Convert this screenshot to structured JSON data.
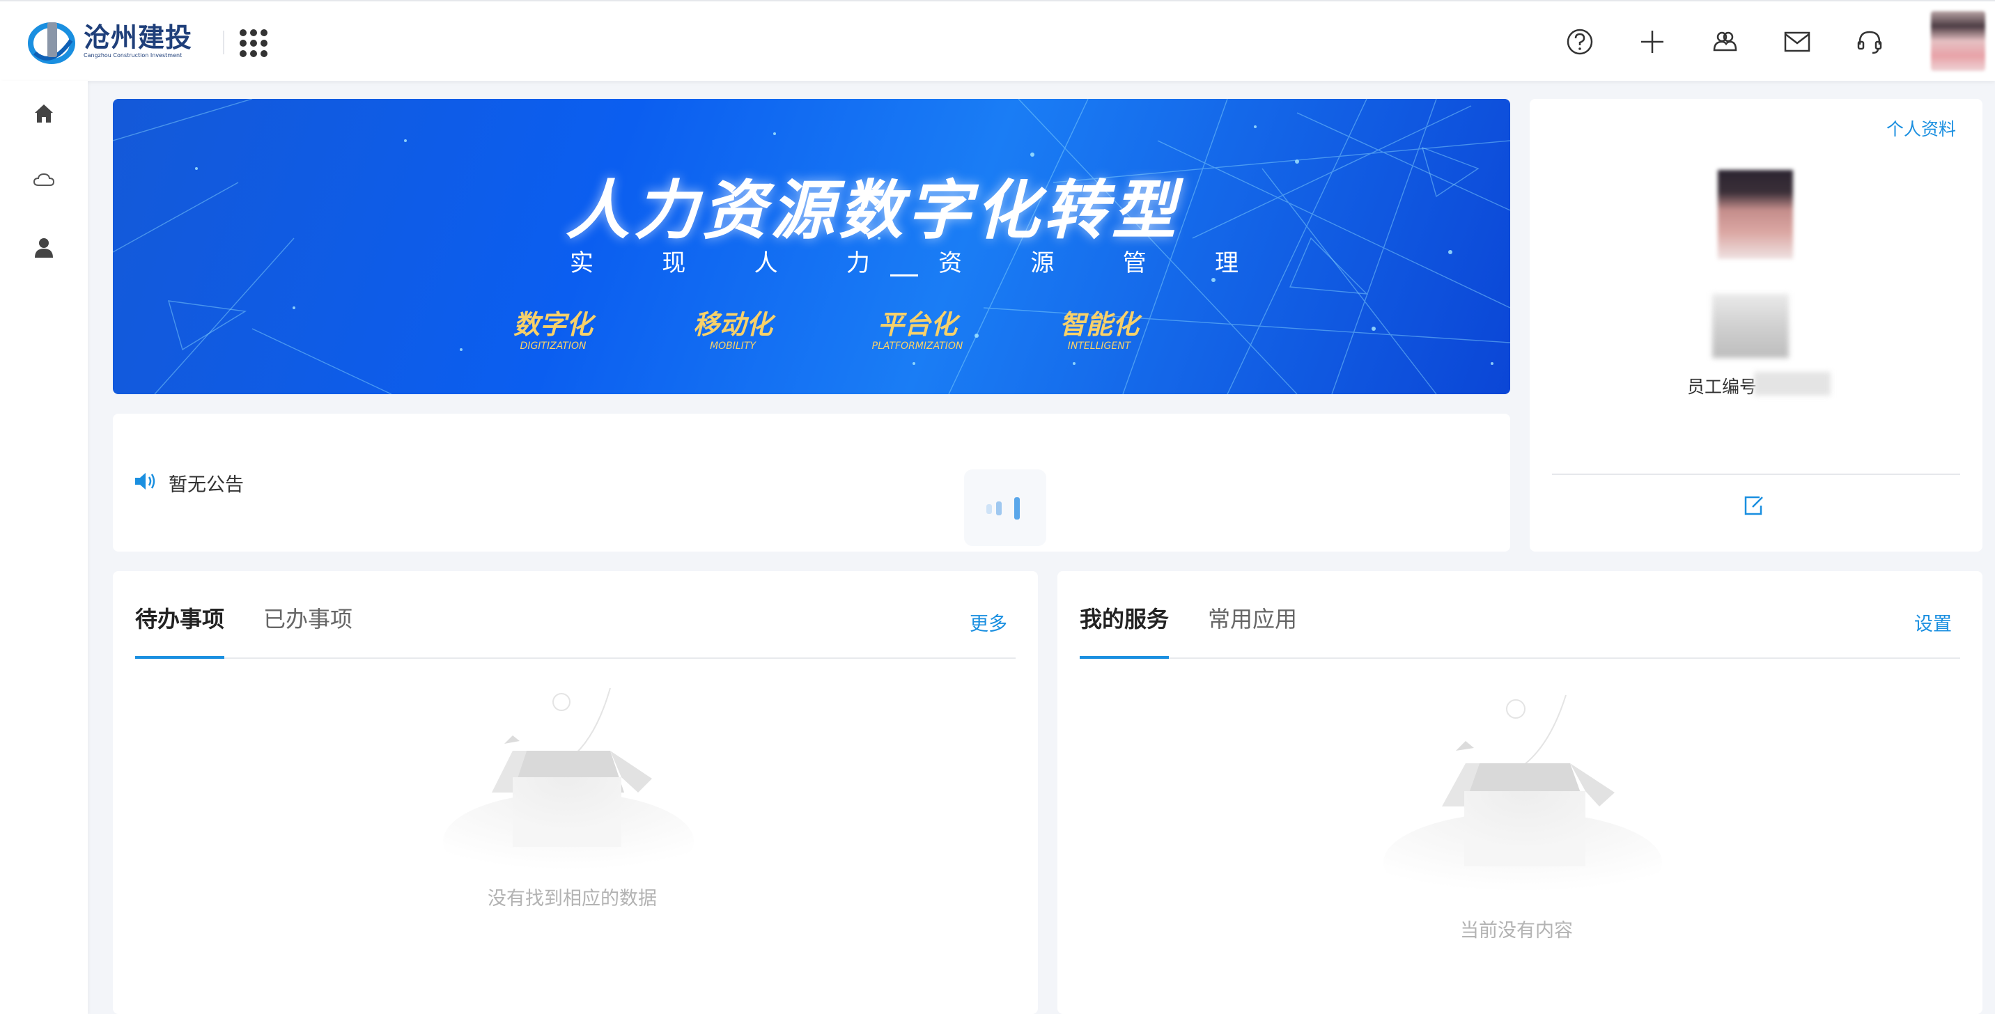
{
  "header": {
    "logo_cn": "沧州建投",
    "logo_en": "Cangzhou Construction Investment",
    "icons": [
      "help-icon",
      "plus-icon",
      "users-icon",
      "mail-icon",
      "headset-icon"
    ]
  },
  "sidebar": {
    "items": [
      "home-icon",
      "cloud-icon",
      "user-icon"
    ]
  },
  "banner": {
    "title": "人力资源数字化转型",
    "subtitle": [
      "实",
      "现",
      "人",
      "力",
      "资",
      "源",
      "管",
      "理"
    ],
    "taglines": [
      {
        "cn": "数字化",
        "en": "DIGITIZATION"
      },
      {
        "cn": "移动化",
        "en": "MOBILITY"
      },
      {
        "cn": "平台化",
        "en": "PLATFORMIZATION"
      },
      {
        "cn": "智能化",
        "en": "INTELLIGENT"
      }
    ]
  },
  "notice": {
    "text": "暂无公告"
  },
  "profile": {
    "link": "个人资料",
    "employee_id_label": "员工编号"
  },
  "todo": {
    "tabs": [
      "待办事项",
      "已办事项"
    ],
    "more": "更多",
    "empty": "没有找到相应的数据"
  },
  "services": {
    "tabs": [
      "我的服务",
      "常用应用"
    ],
    "settings": "设置",
    "empty": "当前没有内容"
  },
  "colors": {
    "accent": "#1a8fe0",
    "banner": "#0b5ef0",
    "tagline": "#f7d16a"
  }
}
